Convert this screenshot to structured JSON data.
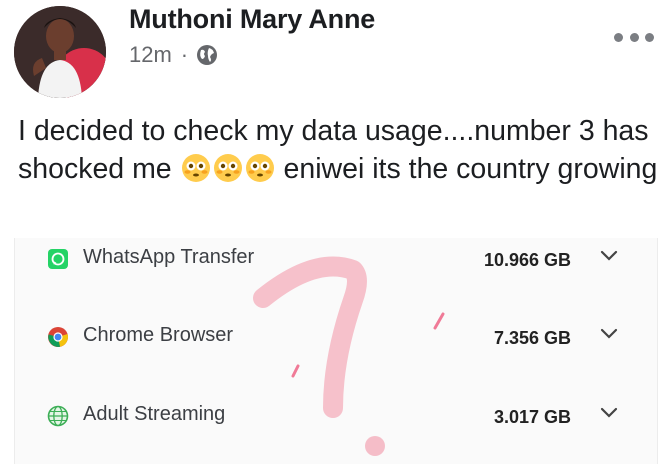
{
  "post": {
    "author": "Muthoni Mary Anne",
    "time": "12m",
    "separator": "·",
    "privacy_icon": "globe-icon",
    "more_icon": "more-options-icon",
    "text_part1": "I decided to check my data usage....number 3 has shocked me ",
    "text_part2": " eniwei its the country growing",
    "emoji": "flushed-face-emoji"
  },
  "data_usage": {
    "rows": [
      {
        "icon": "whatsapp-icon",
        "app": "WhatsApp Transfer",
        "usage": "10.966 GB"
      },
      {
        "icon": "chrome-icon",
        "app": "Chrome Browser",
        "usage": "7.356 GB"
      },
      {
        "icon": "globe-icon",
        "app": "Adult Streaming",
        "usage": "3.017 GB"
      }
    ],
    "expand_icon": "chevron-down-icon",
    "overlay_icon": "question-mark-drawing"
  },
  "colors": {
    "author_text": "#1c1e21",
    "meta_text": "#65676b",
    "whatsapp_green": "#25d366",
    "overlay_pink": "#f4b6c2"
  }
}
